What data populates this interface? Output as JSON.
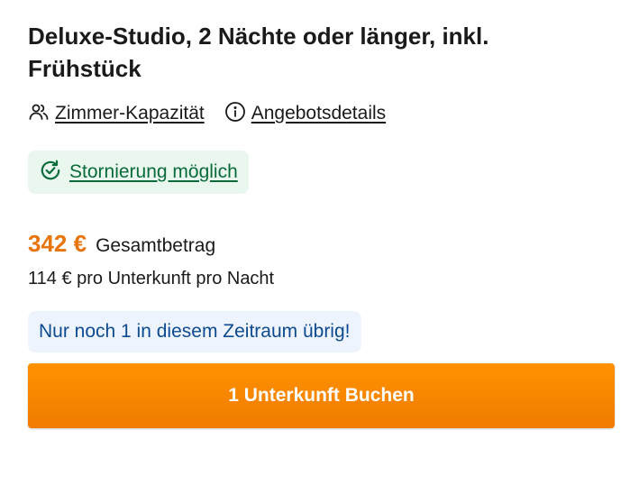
{
  "offer": {
    "title": "Deluxe-Studio, 2 Nächte oder länger, inkl. Frühstück",
    "links": {
      "capacity_label": "Zimmer-Kapazität",
      "details_label": "Angebotsdetails"
    },
    "cancellation_label": "Stornierung möglich",
    "price": {
      "amount": "342 €",
      "label": "Gesamtbetrag",
      "per_night": "114 € pro Unterkunft pro Nacht"
    },
    "scarcity": "Nur noch 1 in diesem Zeitraum übrig!",
    "book_button": "1 Unterkunft Buchen"
  },
  "colors": {
    "price": "#e8740c",
    "cancel_bg": "#e9f7ef",
    "cancel_text": "#0a6b3a",
    "scarcity_bg": "#eef4fd",
    "scarcity_text": "#0d4a8f",
    "button": "#f88800"
  },
  "icons": [
    "people-icon",
    "info-icon",
    "refresh-check-icon"
  ]
}
